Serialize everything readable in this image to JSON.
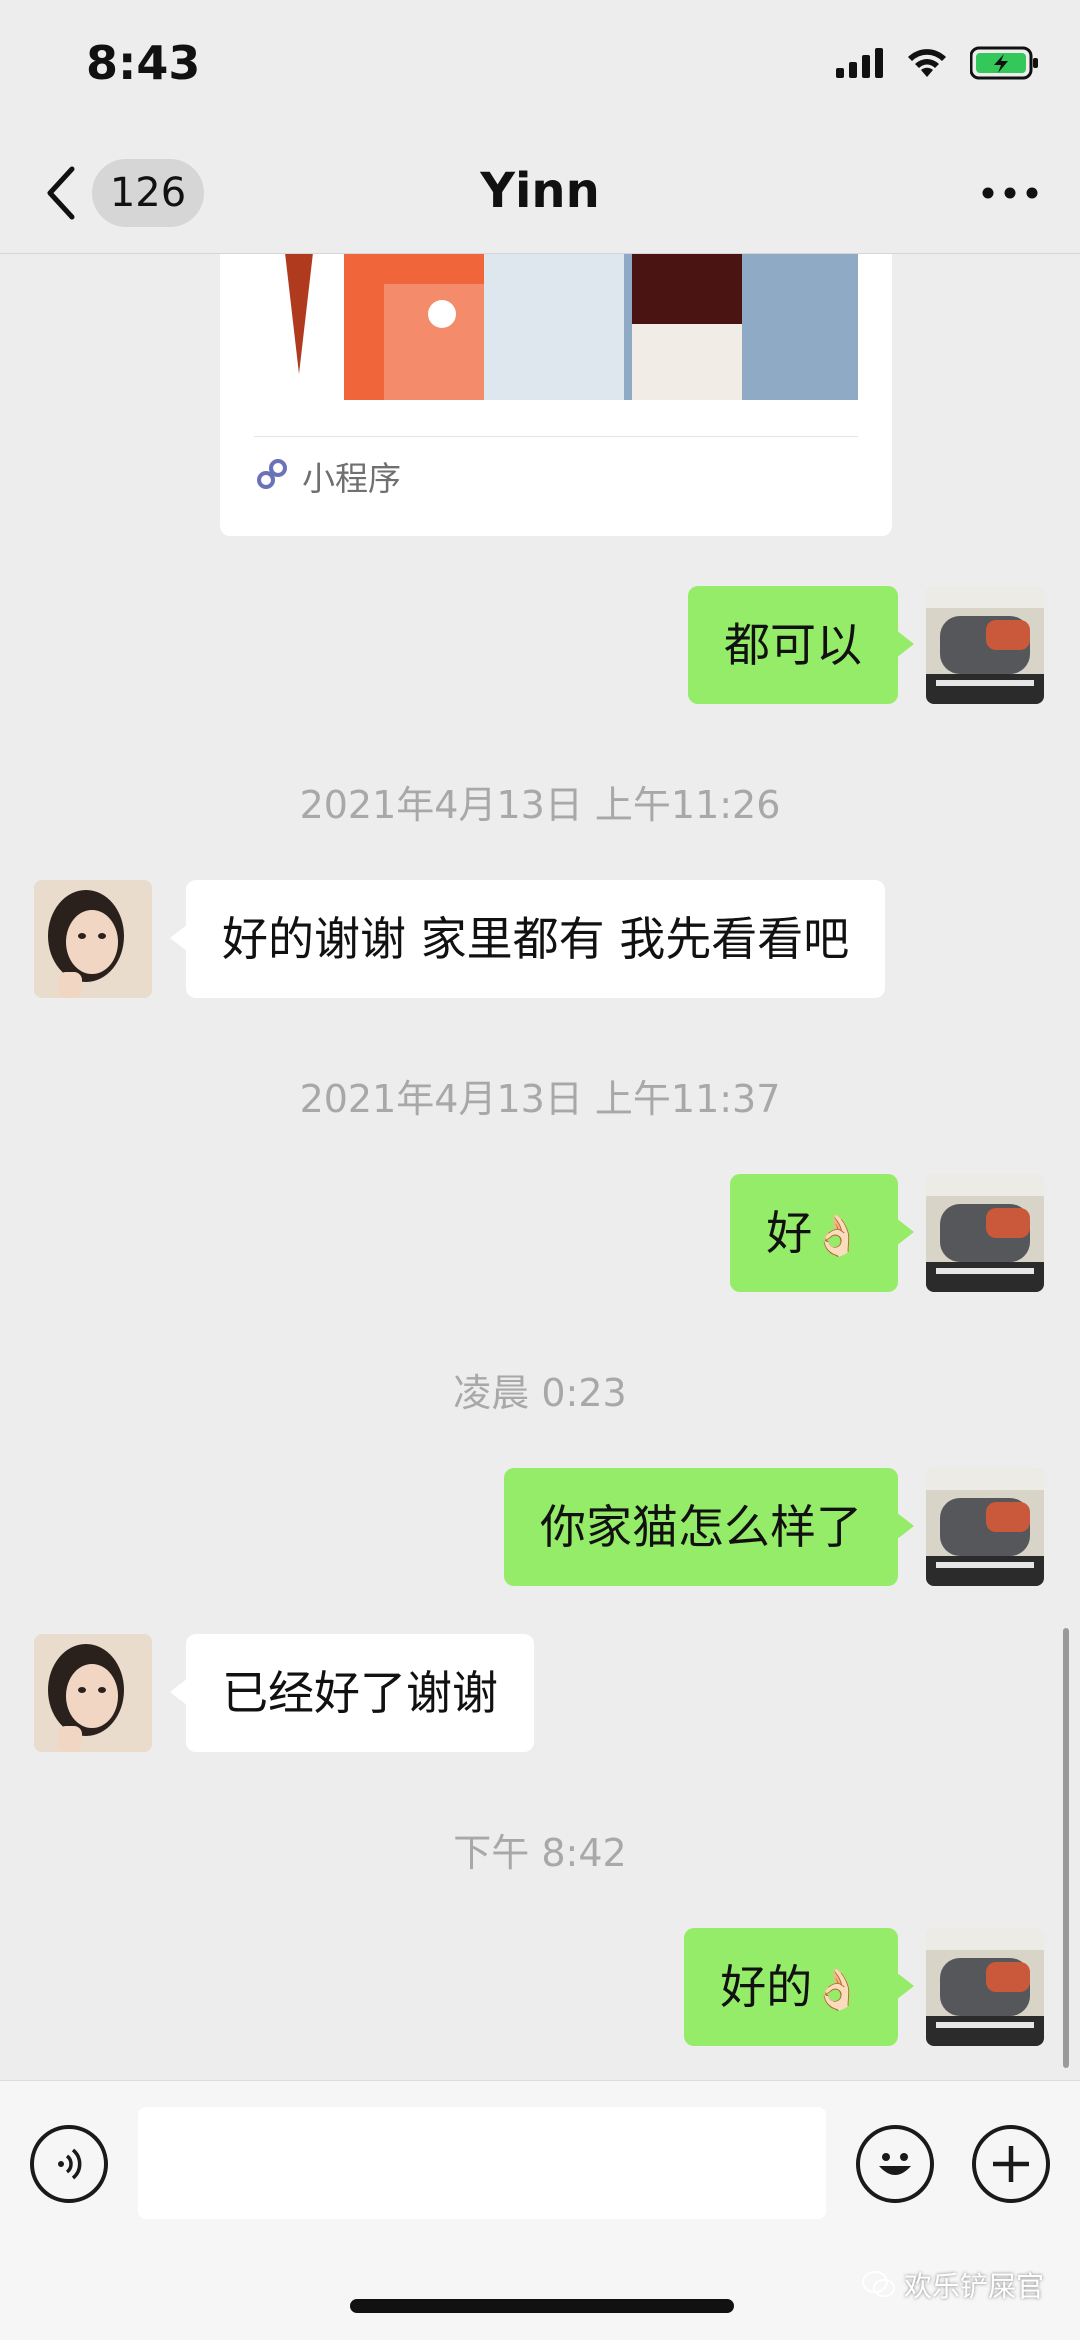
{
  "status_bar": {
    "time": "8:43",
    "icons": [
      "signal-icon",
      "wifi-icon",
      "battery-charging-icon"
    ]
  },
  "nav": {
    "back_icon": "chevron-left-icon",
    "unread_count": "126",
    "title": "Yinn",
    "more_icon": "more-horizontal-icon"
  },
  "mini_program": {
    "label": "小程序",
    "icon": "mini-program-icon"
  },
  "messages": [
    {
      "direction": "out",
      "text": "都可以",
      "emoji": ""
    },
    {
      "direction": "timestamp",
      "text": "2021年4月13日 上午11:26"
    },
    {
      "direction": "in",
      "text": "好的谢谢 家里都有 我先看看吧"
    },
    {
      "direction": "timestamp",
      "text": "2021年4月13日 上午11:37"
    },
    {
      "direction": "out",
      "text": "好",
      "emoji": "👌🏻"
    },
    {
      "direction": "timestamp",
      "text": "凌晨 0:23"
    },
    {
      "direction": "out",
      "text": "你家猫怎么样了",
      "emoji": ""
    },
    {
      "direction": "in",
      "text": "已经好了谢谢"
    },
    {
      "direction": "timestamp",
      "text": "下午 8:42"
    },
    {
      "direction": "out",
      "text": "好的",
      "emoji": "👌🏻"
    }
  ],
  "input_bar": {
    "voice_icon": "voice-icon",
    "emoji_icon": "smiley-icon",
    "plus_icon": "plus-circle-icon",
    "input_value": "",
    "input_placeholder": ""
  },
  "watermark": "欢乐铲屎官",
  "colors": {
    "background": "#ededed",
    "outgoing_bubble": "#95ec69",
    "incoming_bubble": "#ffffff",
    "timestamp": "#a8a8a8"
  }
}
